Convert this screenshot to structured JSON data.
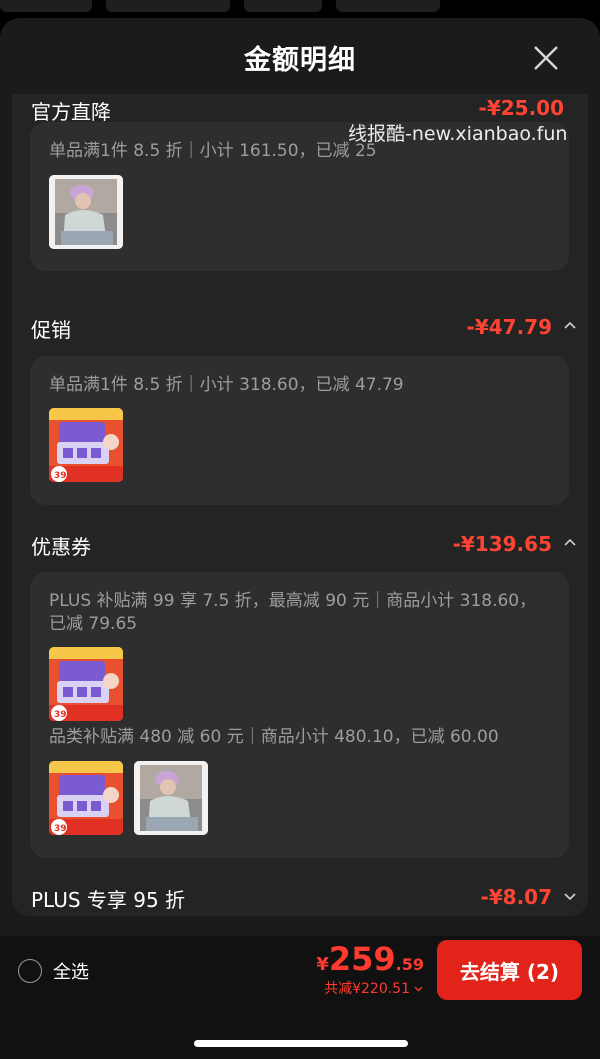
{
  "sheet": {
    "title": "金额明细",
    "watermark": "线报酷-new.xianbao.fun"
  },
  "sections": {
    "partial": {
      "label": "官方直降",
      "amount": "-¥25.00",
      "card_text": "单品满1件 8.5 折｜小计 161.50，已减 25"
    },
    "promo": {
      "label": "促销",
      "amount": "-¥47.79",
      "card_text": "单品满1件 8.5 折｜小计 318.60，已减 47.79"
    },
    "coupon": {
      "label": "优惠券",
      "amount": "-¥139.65",
      "line1": "PLUS 补贴满 99 享 7.5 折，最高减 90 元｜商品小计 318.60，",
      "line2": "已减 79.65",
      "line3": "品类补贴满 480 减 60 元｜商品小计 480.10，已减 60.00"
    },
    "plus": {
      "label": "PLUS 专享 95 折",
      "amount": "-¥8.07"
    }
  },
  "product_thumbs": {
    "promo_badge_text": "39"
  },
  "footer": {
    "select_all": "全选",
    "currency": "¥",
    "price_int": "259",
    "price_dec": ".59",
    "saving": "共减¥220.51",
    "checkout": "去结算 (2)"
  },
  "colors": {
    "accent_red": "#e2231a",
    "amount_red": "#ff4433",
    "sheet_bg": "#1b1b1b",
    "card_bg": "#2e2e2e"
  }
}
